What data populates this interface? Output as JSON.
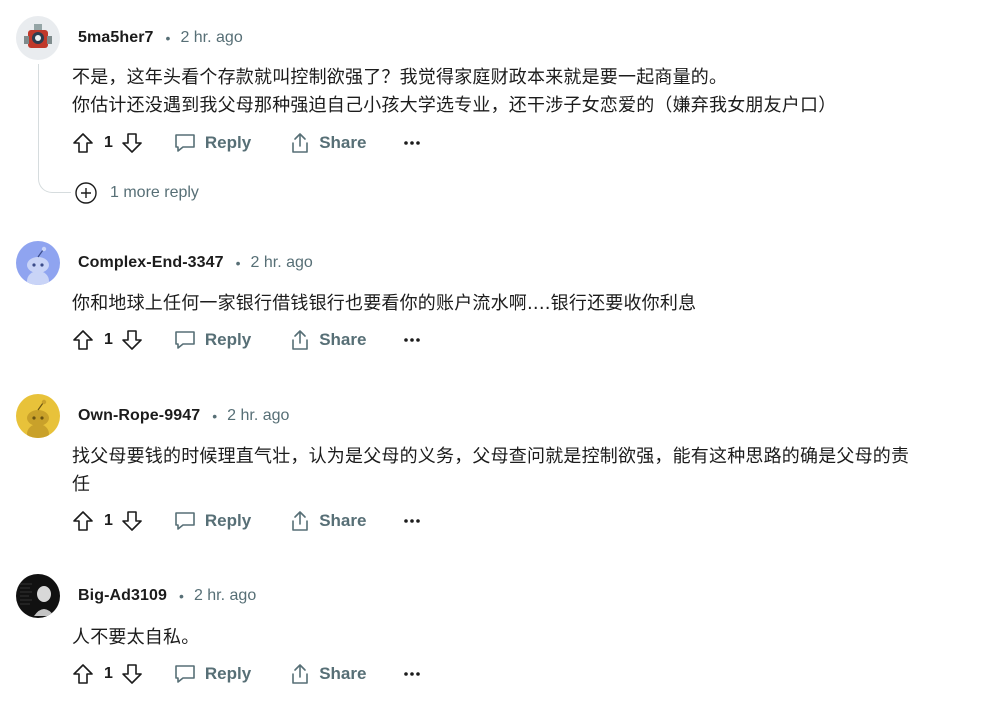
{
  "comments": [
    {
      "username": "5ma5her7",
      "time": "2 hr. ago",
      "lines": [
        "不是，这年头看个存款就叫控制欲强了？我觉得家庭财政本来就是要一起商量的。",
        "你估计还没遇到我父母那种强迫自己小孩大学选专业，还干涉子女恋爱的（嫌弃我女朋友户口）"
      ],
      "votes": "1",
      "reply_label": "Reply",
      "share_label": "Share",
      "avatar": "robot-avatar-icon"
    },
    {
      "username": "Complex-End-3347",
      "time": "2 hr. ago",
      "lines": [
        "你和地球上任何一家银行借钱银行也要看你的账户流水啊....银行还要收你利息"
      ],
      "votes": "1",
      "reply_label": "Reply",
      "share_label": "Share",
      "avatar": "snoo-blue-avatar-icon"
    },
    {
      "username": "Own-Rope-9947",
      "time": "2 hr. ago",
      "lines": [
        "找父母要钱的时候理直气壮，认为是父母的义务，父母查问就是控制欲强，能有这种思路的确是父母的责",
        "任"
      ],
      "votes": "1",
      "reply_label": "Reply",
      "share_label": "Share",
      "avatar": "snoo-yellow-avatar-icon"
    },
    {
      "username": "Big-Ad3109",
      "time": "2 hr. ago",
      "lines": [
        "人不要太自私。"
      ],
      "votes": "1",
      "reply_label": "Reply",
      "share_label": "Share",
      "avatar": "dark-bust-avatar-icon"
    }
  ],
  "more_replies": {
    "label": "1 more reply"
  },
  "colors": {
    "text": "#1c1c1c",
    "meta": "#576f76",
    "thread": "#d6dcde",
    "snoo_blue": "#8fa4f0",
    "snoo_yellow": "#e8c23a"
  }
}
